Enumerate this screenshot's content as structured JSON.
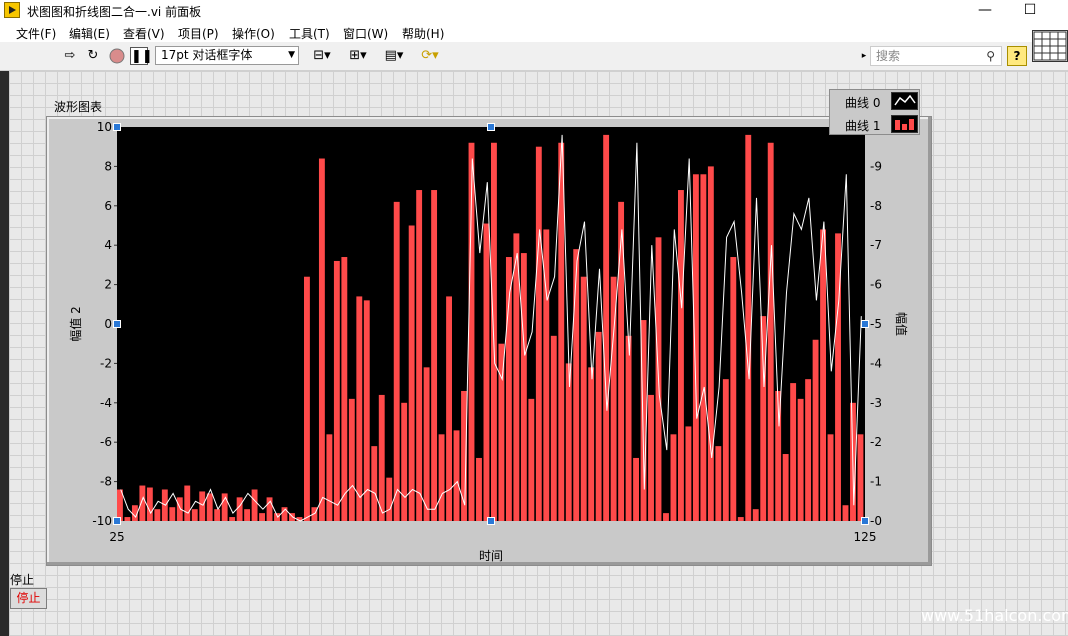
{
  "window": {
    "title": "状图图和折线图二合一.vi 前面板",
    "minimize": "—",
    "maximize": "☐"
  },
  "menu": [
    "文件(F)",
    "编辑(E)",
    "查看(V)",
    "项目(P)",
    "操作(O)",
    "工具(T)",
    "窗口(W)",
    "帮助(H)"
  ],
  "toolbar": {
    "run_icon": "run-arrow-icon",
    "font_select": "17pt 对话框字体",
    "search_placeholder": "搜索",
    "help_label": "?"
  },
  "chart_label": "波形图表",
  "legend": [
    {
      "name": "曲线 0",
      "color": "#ffffff",
      "style": "line"
    },
    {
      "name": "曲线 1",
      "color": "#ff4a4a",
      "style": "bar"
    }
  ],
  "stop": {
    "label": "停止",
    "button": "停止"
  },
  "watermark": "www.51halcon.com",
  "chart_data": {
    "type": "bar",
    "title": "波形图表",
    "xlabel": "时间",
    "ylabel_left": "幅值 2",
    "ylabel_right": "幅值",
    "xlim": [
      25,
      125
    ],
    "ylim_left": [
      -10,
      10
    ],
    "ylim_right": [
      0,
      10
    ],
    "xticks": [
      "25",
      "125"
    ],
    "yticks_left": [
      "10",
      "8",
      "6",
      "4",
      "2",
      "0",
      "-2",
      "-4",
      "-6",
      "-8",
      "-10"
    ],
    "yticks_right": [
      "9",
      "8",
      "7",
      "6",
      "5",
      "4",
      "3",
      "2",
      "1",
      "0"
    ],
    "series": [
      {
        "name": "曲线 1",
        "axis": "left",
        "type": "bar",
        "color": "#ff4a4a",
        "values": [
          -8.4,
          -9.8,
          -9.2,
          -8.2,
          -8.3,
          -9.4,
          -8.4,
          -9.3,
          -8.8,
          -8.2,
          -9.4,
          -8.5,
          -8.6,
          -9.4,
          -8.6,
          -9.8,
          -8.8,
          -9.4,
          -8.4,
          -9.6,
          -8.8,
          -9.6,
          -9.3,
          -9.6,
          -9.8,
          2.4,
          -9.3,
          8.4,
          -5.6,
          3.2,
          3.4,
          -3.8,
          1.4,
          1.2,
          -6.2,
          -3.6,
          -7.8,
          6.2,
          -4.0,
          5.0,
          6.8,
          -2.2,
          6.8,
          -5.6,
          1.4,
          -5.4,
          -3.4,
          9.2,
          -6.8,
          5.1,
          9.2,
          -1.0,
          3.4,
          4.6,
          3.6,
          -3.8,
          9.0,
          4.8,
          -0.6,
          9.2,
          -2.0,
          3.8,
          2.4,
          -2.2,
          -0.4,
          9.6,
          2.4,
          6.2,
          -0.6,
          -6.8,
          0.2,
          -3.6,
          4.4,
          -9.6,
          -5.6,
          6.8,
          -5.2,
          7.6,
          7.6,
          8.0,
          -6.2,
          -2.8,
          3.4,
          -9.8,
          9.6,
          -9.4,
          0.4,
          9.2,
          -3.4,
          -6.6,
          -3.0,
          -3.8,
          -2.8,
          -0.8,
          4.8,
          -5.6,
          4.6,
          -9.2,
          -4.0,
          -5.6
        ]
      },
      {
        "name": "曲线 0",
        "axis": "right",
        "type": "line",
        "color": "#ffffff",
        "values": [
          0.8,
          0.3,
          0.1,
          0.6,
          0.2,
          0.5,
          0.4,
          0.7,
          0.3,
          0.2,
          0.5,
          0.4,
          0.8,
          0.3,
          0.6,
          0.2,
          0.4,
          0.7,
          0.5,
          0.3,
          0.5,
          0.1,
          0.3,
          0.1,
          0.0,
          0.1,
          0.2,
          0.6,
          0.5,
          0.4,
          0.7,
          0.9,
          0.6,
          0.8,
          0.7,
          0.2,
          0.3,
          0.8,
          0.6,
          0.8,
          0.7,
          0.3,
          0.3,
          0.7,
          0.8,
          1.0,
          0.4,
          9.2,
          6.8,
          8.6,
          4.0,
          3.6,
          5.8,
          6.8,
          4.2,
          4.8,
          7.4,
          5.6,
          6.2,
          9.8,
          3.4,
          6.6,
          7.6,
          3.6,
          6.4,
          2.8,
          5.0,
          7.4,
          4.2,
          9.6,
          0.8,
          7.0,
          3.2,
          1.8,
          7.4,
          5.4,
          9.2,
          2.6,
          3.4,
          1.6,
          3.4,
          7.2,
          7.6,
          5.8,
          3.6,
          8.2,
          3.4,
          7.0,
          2.4,
          5.8,
          7.8,
          7.4,
          8.2,
          5.6,
          7.6,
          3.8,
          5.6,
          8.8,
          0.4,
          5.2
        ]
      }
    ]
  }
}
